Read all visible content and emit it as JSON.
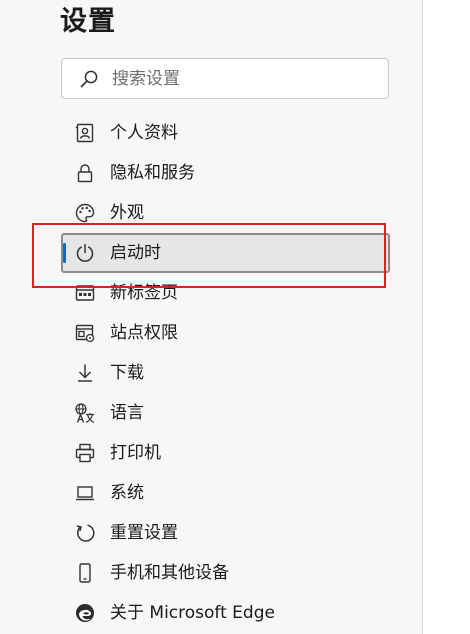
{
  "page": {
    "title": "设置"
  },
  "search": {
    "placeholder": "搜索设置",
    "value": ""
  },
  "sidebar": {
    "active_index": 3,
    "items": [
      {
        "label": "个人资料",
        "icon": "profile-icon"
      },
      {
        "label": "隐私和服务",
        "icon": "lock-icon"
      },
      {
        "label": "外观",
        "icon": "palette-icon"
      },
      {
        "label": "启动时",
        "icon": "power-icon"
      },
      {
        "label": "新标签页",
        "icon": "new-tab-icon"
      },
      {
        "label": "站点权限",
        "icon": "site-permissions-icon"
      },
      {
        "label": "下载",
        "icon": "download-icon"
      },
      {
        "label": "语言",
        "icon": "language-icon"
      },
      {
        "label": "打印机",
        "icon": "printer-icon"
      },
      {
        "label": "系统",
        "icon": "system-icon"
      },
      {
        "label": "重置设置",
        "icon": "reset-icon"
      },
      {
        "label": "手机和其他设备",
        "icon": "phone-icon"
      },
      {
        "label": "关于 Microsoft Edge",
        "icon": "edge-icon"
      }
    ]
  },
  "colors": {
    "background": "#f7f7f7",
    "active_item_background": "#e6e6e6",
    "accent": "#0f6cbd",
    "highlight_annotation": "#e02020"
  }
}
